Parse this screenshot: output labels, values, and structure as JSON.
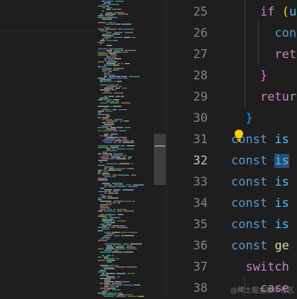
{
  "line_numbers": [
    {
      "n": "25",
      "active": false
    },
    {
      "n": "26",
      "active": false
    },
    {
      "n": "27",
      "active": false
    },
    {
      "n": "28",
      "active": false
    },
    {
      "n": "29",
      "active": false
    },
    {
      "n": "30",
      "active": false
    },
    {
      "n": "31",
      "active": false
    },
    {
      "n": "32",
      "active": true
    },
    {
      "n": "33",
      "active": false
    },
    {
      "n": "34",
      "active": false
    },
    {
      "n": "35",
      "active": false
    },
    {
      "n": "36",
      "active": false
    },
    {
      "n": "37",
      "active": false
    },
    {
      "n": "38",
      "active": false
    }
  ],
  "code_lines": [
    [
      {
        "t": "    "
      },
      {
        "t": "if",
        "c": "ctl"
      },
      {
        "t": " "
      },
      {
        "t": "(",
        "c": "p1"
      },
      {
        "t": "us",
        "c": "id"
      }
    ],
    [
      {
        "t": "      "
      },
      {
        "t": "cons",
        "c": "kw"
      }
    ],
    [
      {
        "t": "      "
      },
      {
        "t": "retu",
        "c": "ctl"
      }
    ],
    [
      {
        "t": "    "
      },
      {
        "t": "}",
        "c": "p2"
      }
    ],
    [
      {
        "t": "    "
      },
      {
        "t": "return",
        "c": "ctl"
      }
    ],
    [
      {
        "t": "  "
      },
      {
        "t": "}",
        "c": "p3"
      }
    ],
    [
      {
        "t": "const",
        "c": "kw"
      },
      {
        "t": " "
      },
      {
        "t": "is",
        "c": "id"
      }
    ],
    [
      {
        "t": "const",
        "c": "kw"
      },
      {
        "t": " "
      },
      {
        "t": "is",
        "c": "id",
        "sel": true
      }
    ],
    [
      {
        "t": "const",
        "c": "kw"
      },
      {
        "t": " "
      },
      {
        "t": "is",
        "c": "id"
      }
    ],
    [
      {
        "t": "const",
        "c": "kw"
      },
      {
        "t": " "
      },
      {
        "t": "is",
        "c": "id"
      }
    ],
    [
      {
        "t": "const",
        "c": "kw"
      },
      {
        "t": " "
      },
      {
        "t": "is",
        "c": "id"
      }
    ],
    [
      {
        "t": "const",
        "c": "kw"
      },
      {
        "t": " "
      },
      {
        "t": "ge",
        "c": "fn"
      }
    ],
    [
      {
        "t": "  "
      },
      {
        "t": "switch",
        "c": "ctl"
      }
    ],
    [
      {
        "t": "    "
      },
      {
        "t": "case",
        "c": "ctl"
      }
    ]
  ],
  "colors": {
    "keyword": "#569cd6",
    "control": "#c586c0",
    "identifier": "#4fc1ff",
    "bracket_gold": "#ffd700",
    "bracket_orchid": "#da70d6",
    "bracket_blue": "#179fff",
    "selection": "#264f78",
    "bulb": "#ffcc00"
  },
  "icons": {
    "bulb": "lightbulb-icon"
  },
  "watermark": "@稀土掘金技术社区"
}
